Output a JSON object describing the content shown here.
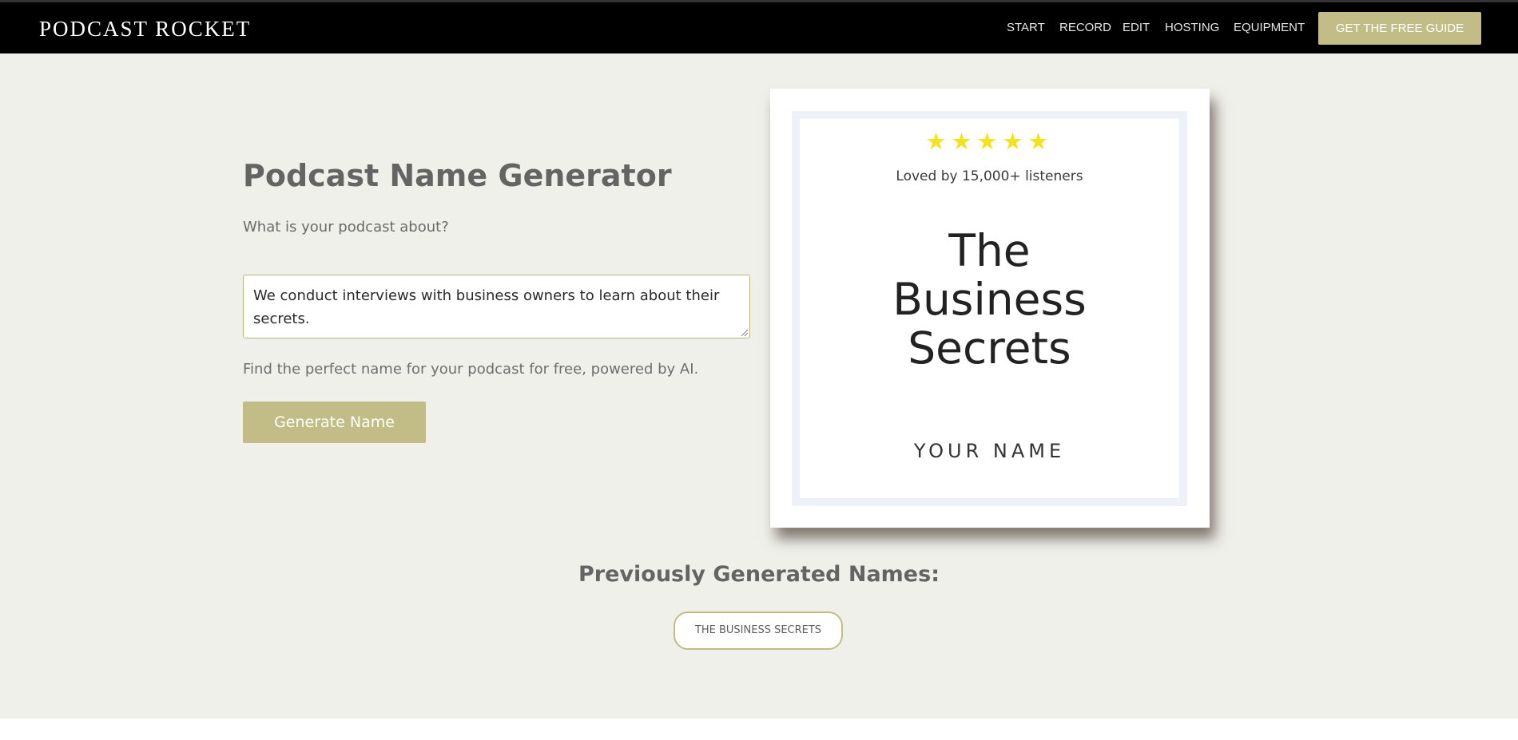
{
  "nav": {
    "logo": "PODCAST ROCKET",
    "links": [
      "START",
      "RECORD",
      "EDIT",
      "HOSTING",
      "EQUIPMENT"
    ],
    "cta": "GET THE FREE GUIDE"
  },
  "generator": {
    "title": "Podcast Name Generator",
    "subtitle": "What is your podcast about?",
    "input_value": "We conduct interviews with business owners to learn about their secrets.",
    "helper": "Find the perfect name for your podcast for free, powered by AI.",
    "button_label": "Generate Name"
  },
  "cover": {
    "stars": "★★★★★",
    "rating_text": "Loved by 15,000+ listeners",
    "title_lines": [
      "The",
      "Business",
      "Secrets"
    ],
    "author": "YOUR NAME"
  },
  "previous": {
    "heading": "Previously Generated Names:",
    "names": [
      "THE BUSINESS SECRETS"
    ]
  },
  "colors": {
    "accent": "#c2bd86",
    "background": "#f0f0ea",
    "nav_bg": "#000000",
    "stars": "#f4e31a",
    "cover_border": "#eef1f8"
  }
}
